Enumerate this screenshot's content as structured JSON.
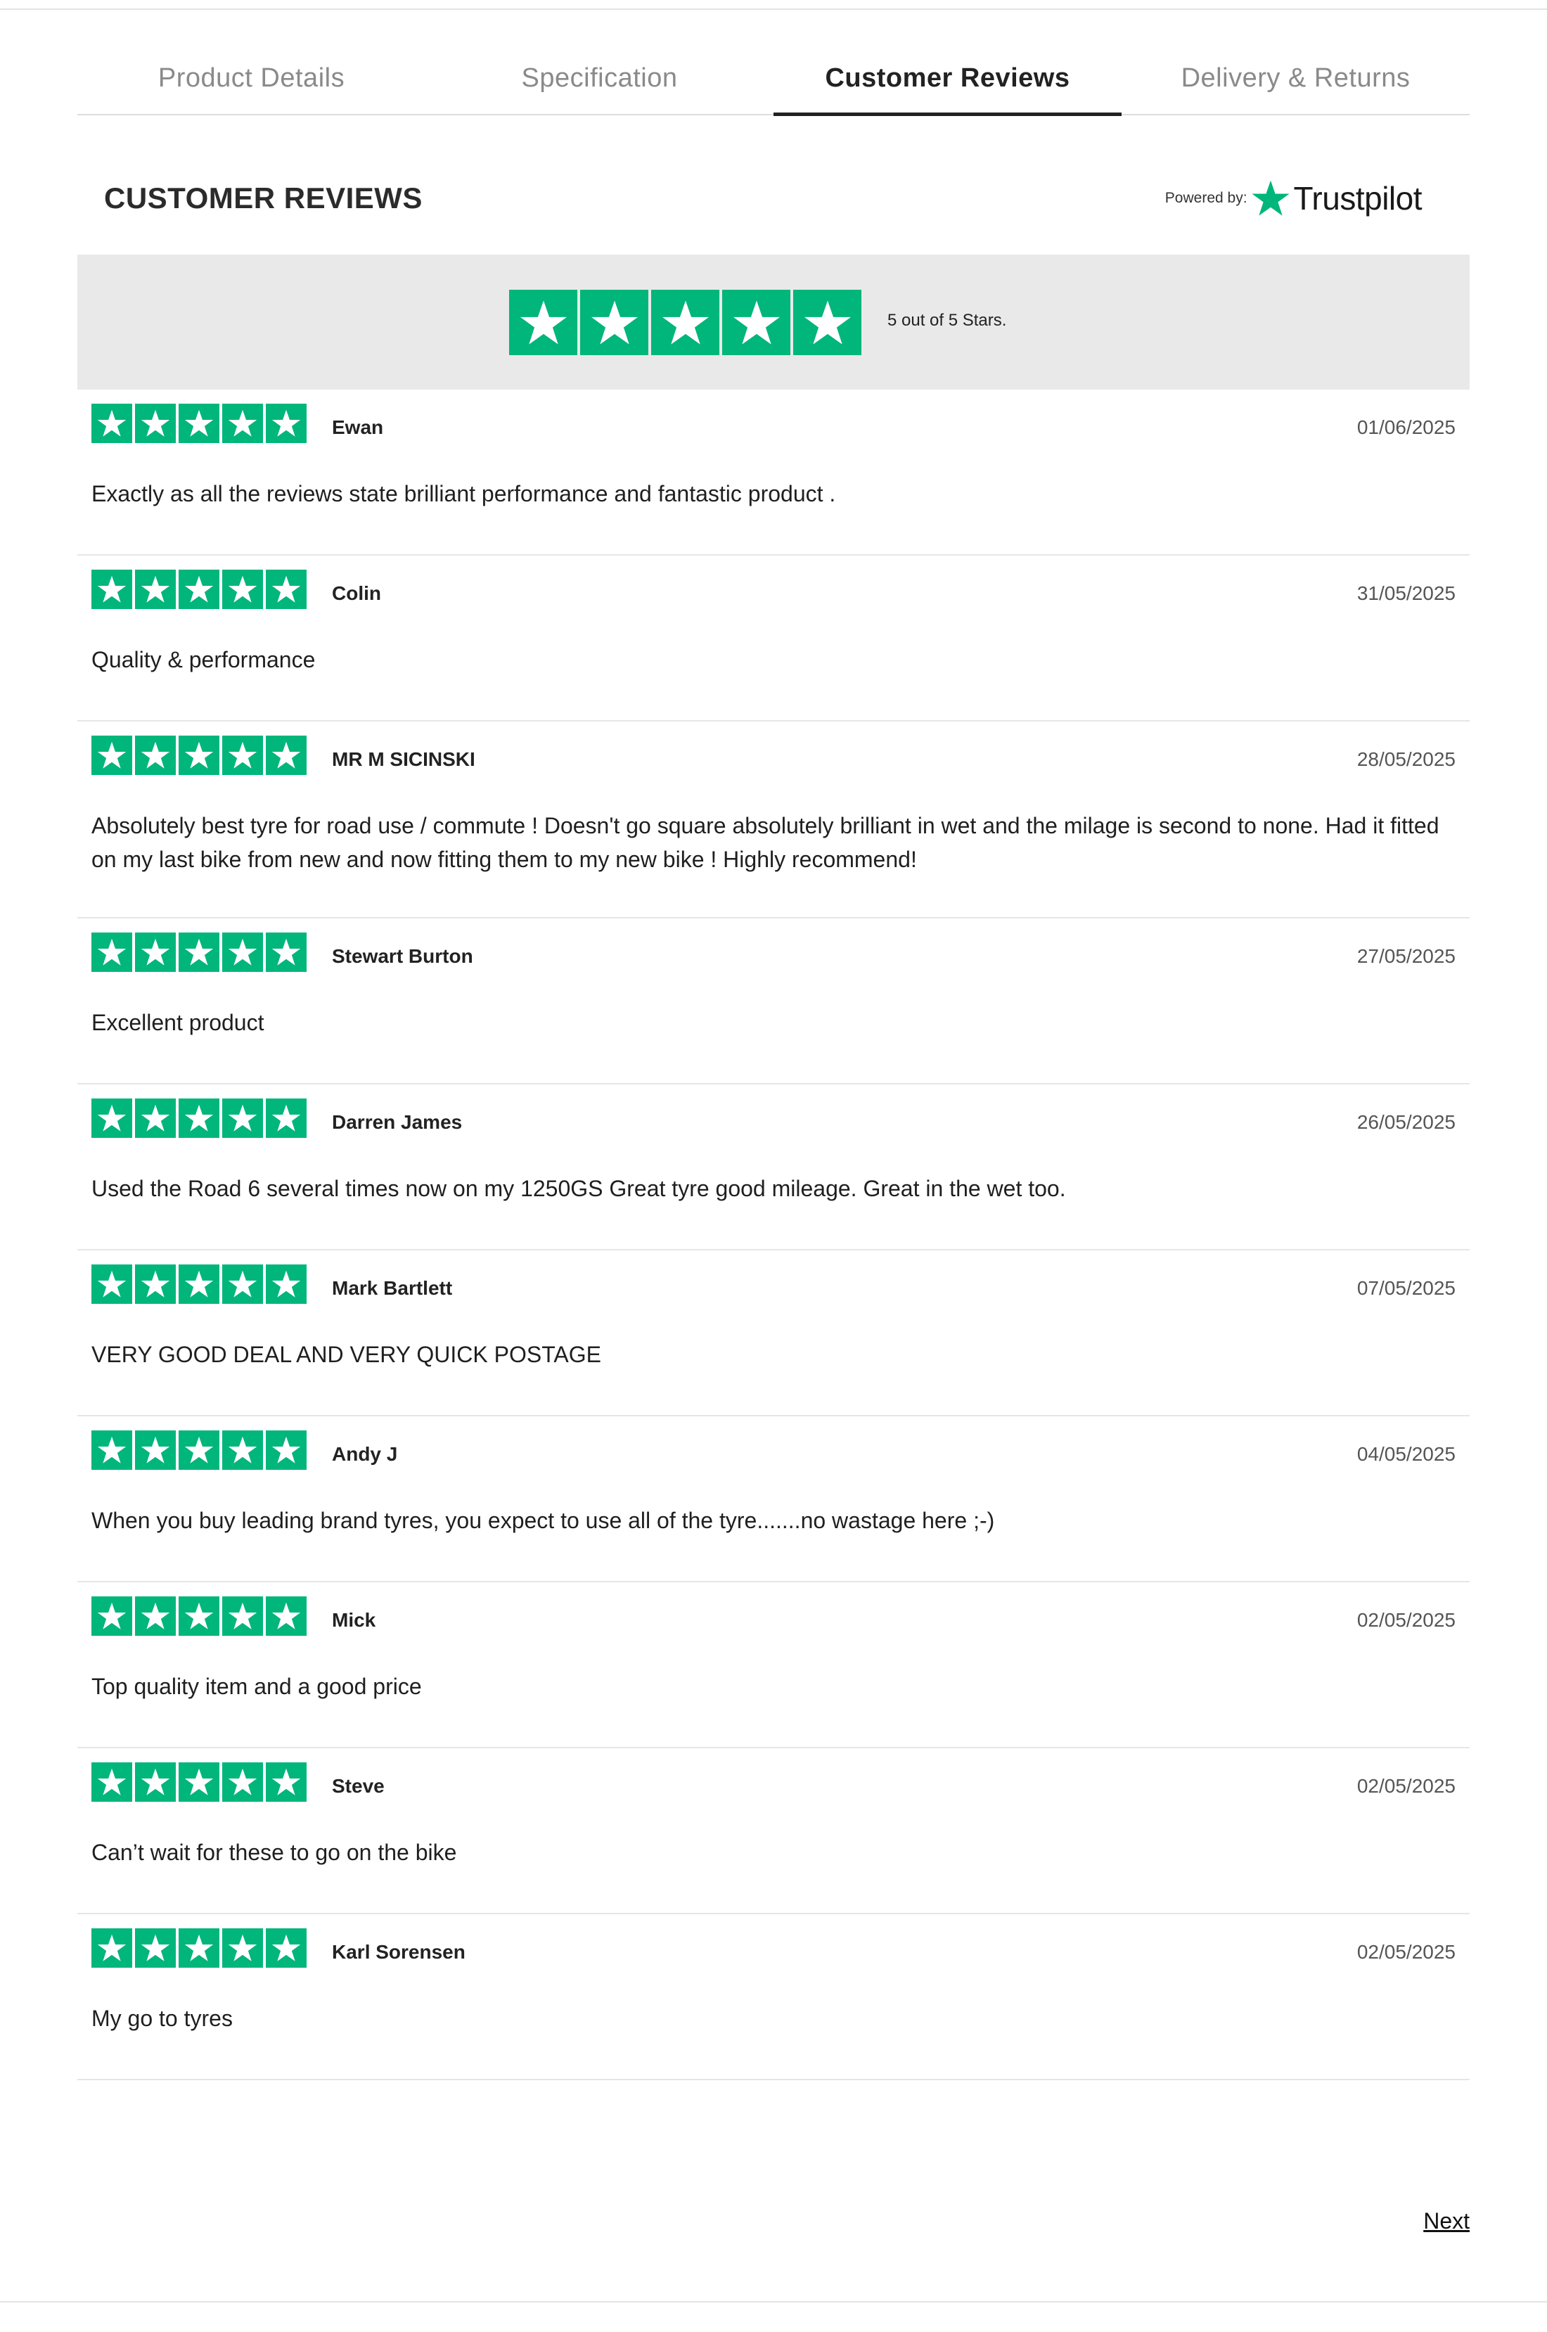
{
  "tabs": [
    {
      "label": "Product Details",
      "active": false
    },
    {
      "label": "Specification",
      "active": false
    },
    {
      "label": "Customer Reviews",
      "active": true
    },
    {
      "label": "Delivery & Returns",
      "active": false
    }
  ],
  "header": {
    "title": "CUSTOMER REVIEWS",
    "powered_by": "Powered by:",
    "brand": "Trustpilot"
  },
  "summary": {
    "rating": 5,
    "max_rating": 5,
    "text": "5 out of 5 Stars."
  },
  "colors": {
    "star_green": "#00b67a",
    "summary_bg": "#e9e9e9"
  },
  "reviews": [
    {
      "author": "Ewan",
      "date": "01/06/2025",
      "rating": 5,
      "text": "Exactly as all the reviews state brilliant performance and fantastic product ."
    },
    {
      "author": "Colin",
      "date": "31/05/2025",
      "rating": 5,
      "text": "Quality & performance"
    },
    {
      "author": "MR M SICINSKI",
      "date": "28/05/2025",
      "rating": 5,
      "text": "Absolutely best tyre for road use / commute ! Doesn't go square absolutely brilliant in wet and the milage is second to none. Had it fitted on my last bike from new and now fitting them to my new bike ! Highly recommend!"
    },
    {
      "author": "Stewart Burton",
      "date": "27/05/2025",
      "rating": 5,
      "text": "Excellent product"
    },
    {
      "author": "Darren James",
      "date": "26/05/2025",
      "rating": 5,
      "text": "Used the Road 6 several times now on my 1250GS Great tyre good mileage. Great in the wet too."
    },
    {
      "author": "Mark Bartlett",
      "date": "07/05/2025",
      "rating": 5,
      "text": "VERY GOOD DEAL AND VERY QUICK POSTAGE"
    },
    {
      "author": "Andy J",
      "date": "04/05/2025",
      "rating": 5,
      "text": "When you buy leading brand tyres, you expect to use all of the tyre.......no wastage here ;-)"
    },
    {
      "author": "Mick",
      "date": "02/05/2025",
      "rating": 5,
      "text": "Top quality item and a good price"
    },
    {
      "author": "Steve",
      "date": "02/05/2025",
      "rating": 5,
      "text": "Can’t wait for these to go on the bike"
    },
    {
      "author": "Karl Sorensen",
      "date": "02/05/2025",
      "rating": 5,
      "text": "My go to tyres"
    }
  ],
  "pagination": {
    "next_label": "Next"
  }
}
